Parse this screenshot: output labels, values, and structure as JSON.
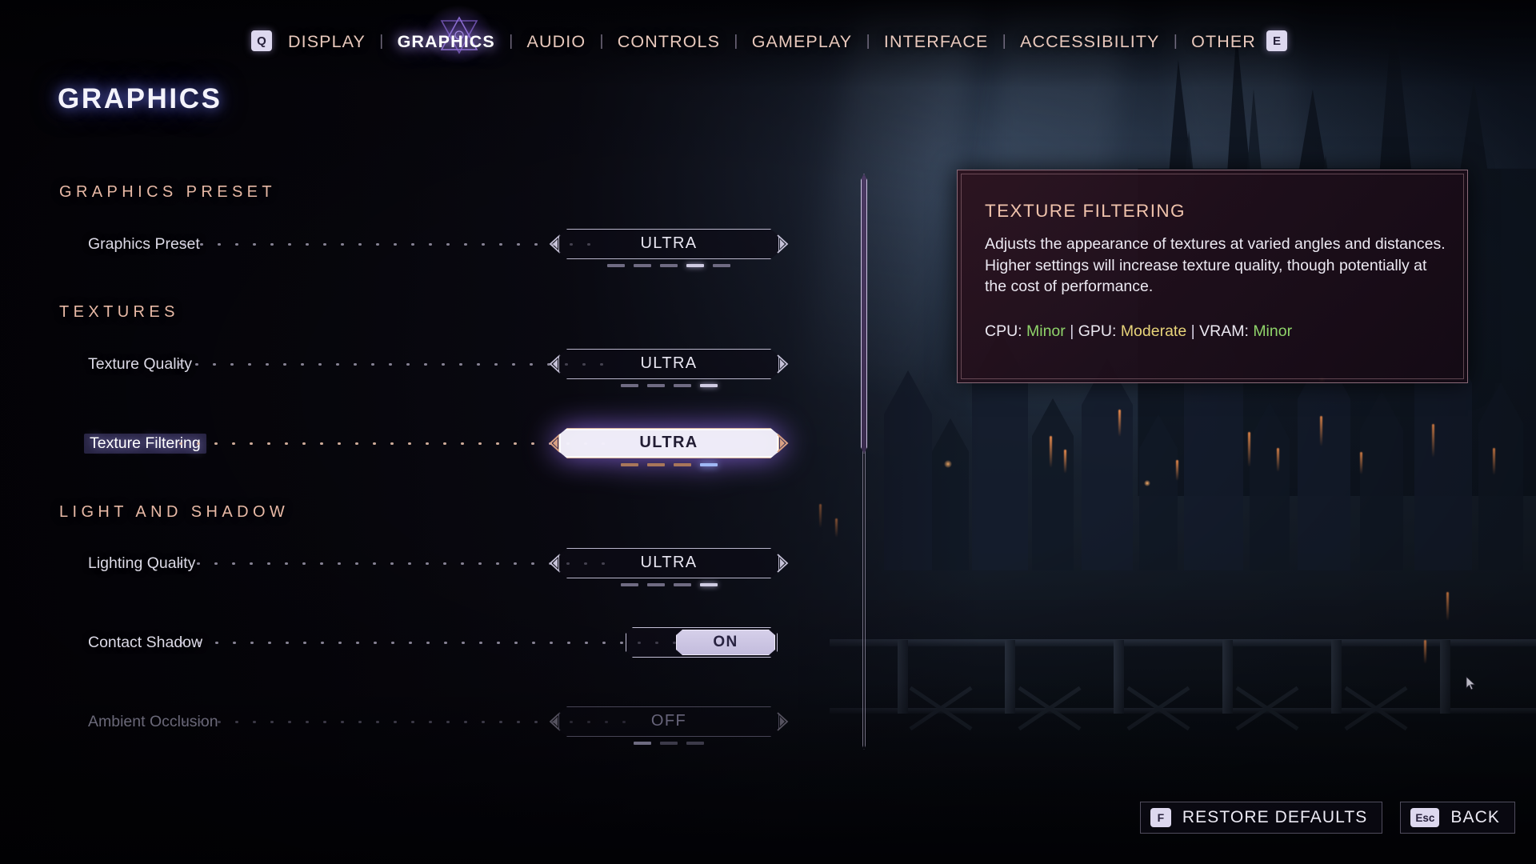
{
  "nav": {
    "prev_key": "Q",
    "next_key": "E",
    "separator": "|",
    "items": [
      {
        "label": "DISPLAY",
        "active": false
      },
      {
        "label": "GRAPHICS",
        "active": true
      },
      {
        "label": "AUDIO",
        "active": false
      },
      {
        "label": "CONTROLS",
        "active": false
      },
      {
        "label": "GAMEPLAY",
        "active": false
      },
      {
        "label": "INTERFACE",
        "active": false
      },
      {
        "label": "ACCESSIBILITY",
        "active": false
      },
      {
        "label": "OTHER",
        "active": false
      }
    ]
  },
  "page": {
    "title": "GRAPHICS"
  },
  "groups": [
    {
      "heading": "GRAPHICS PRESET"
    },
    {
      "heading": "TEXTURES"
    },
    {
      "heading": "LIGHT AND SHADOW"
    }
  ],
  "rows": [
    {
      "label": "Graphics Preset",
      "value": "ULTRA",
      "type": "stepper",
      "tick_count": 5,
      "tick_active": 4,
      "state": "normal"
    },
    {
      "label": "Texture Quality",
      "value": "ULTRA",
      "type": "stepper",
      "tick_count": 4,
      "tick_active": 4,
      "state": "normal"
    },
    {
      "label": "Texture Filtering",
      "value": "ULTRA",
      "type": "stepper",
      "tick_count": 4,
      "tick_active": 4,
      "state": "selected"
    },
    {
      "label": "Lighting Quality",
      "value": "ULTRA",
      "type": "stepper",
      "tick_count": 4,
      "tick_active": 4,
      "state": "normal"
    },
    {
      "label": "Contact Shadow",
      "value": "ON",
      "type": "toggle",
      "state": "normal"
    },
    {
      "label": "Ambient Occlusion",
      "value": "OFF",
      "type": "stepper",
      "tick_count": 3,
      "tick_active": 1,
      "state": "disabled"
    }
  ],
  "tooltip": {
    "title": "TEXTURE FILTERING",
    "body": "Adjusts the appearance of textures at varied angles and distances. Higher settings will increase texture quality, though potentially at the cost of performance.",
    "impact": {
      "cpu_label": "CPU:",
      "cpu_value": "Minor",
      "gpu_label": "GPU:",
      "gpu_value": "Moderate",
      "vram_label": "VRAM:",
      "vram_value": "Minor",
      "divider": "|"
    }
  },
  "footer": {
    "restore_key": "F",
    "restore_label": "RESTORE DEFAULTS",
    "back_key": "Esc",
    "back_label": "BACK"
  },
  "colors": {
    "accent_copper": "#e8b9a6",
    "nav_text": "#e9c9bd",
    "impact_minor": "#8fd46a",
    "impact_moderate": "#e8d47a",
    "selection_glow": "#9b6ef5"
  }
}
